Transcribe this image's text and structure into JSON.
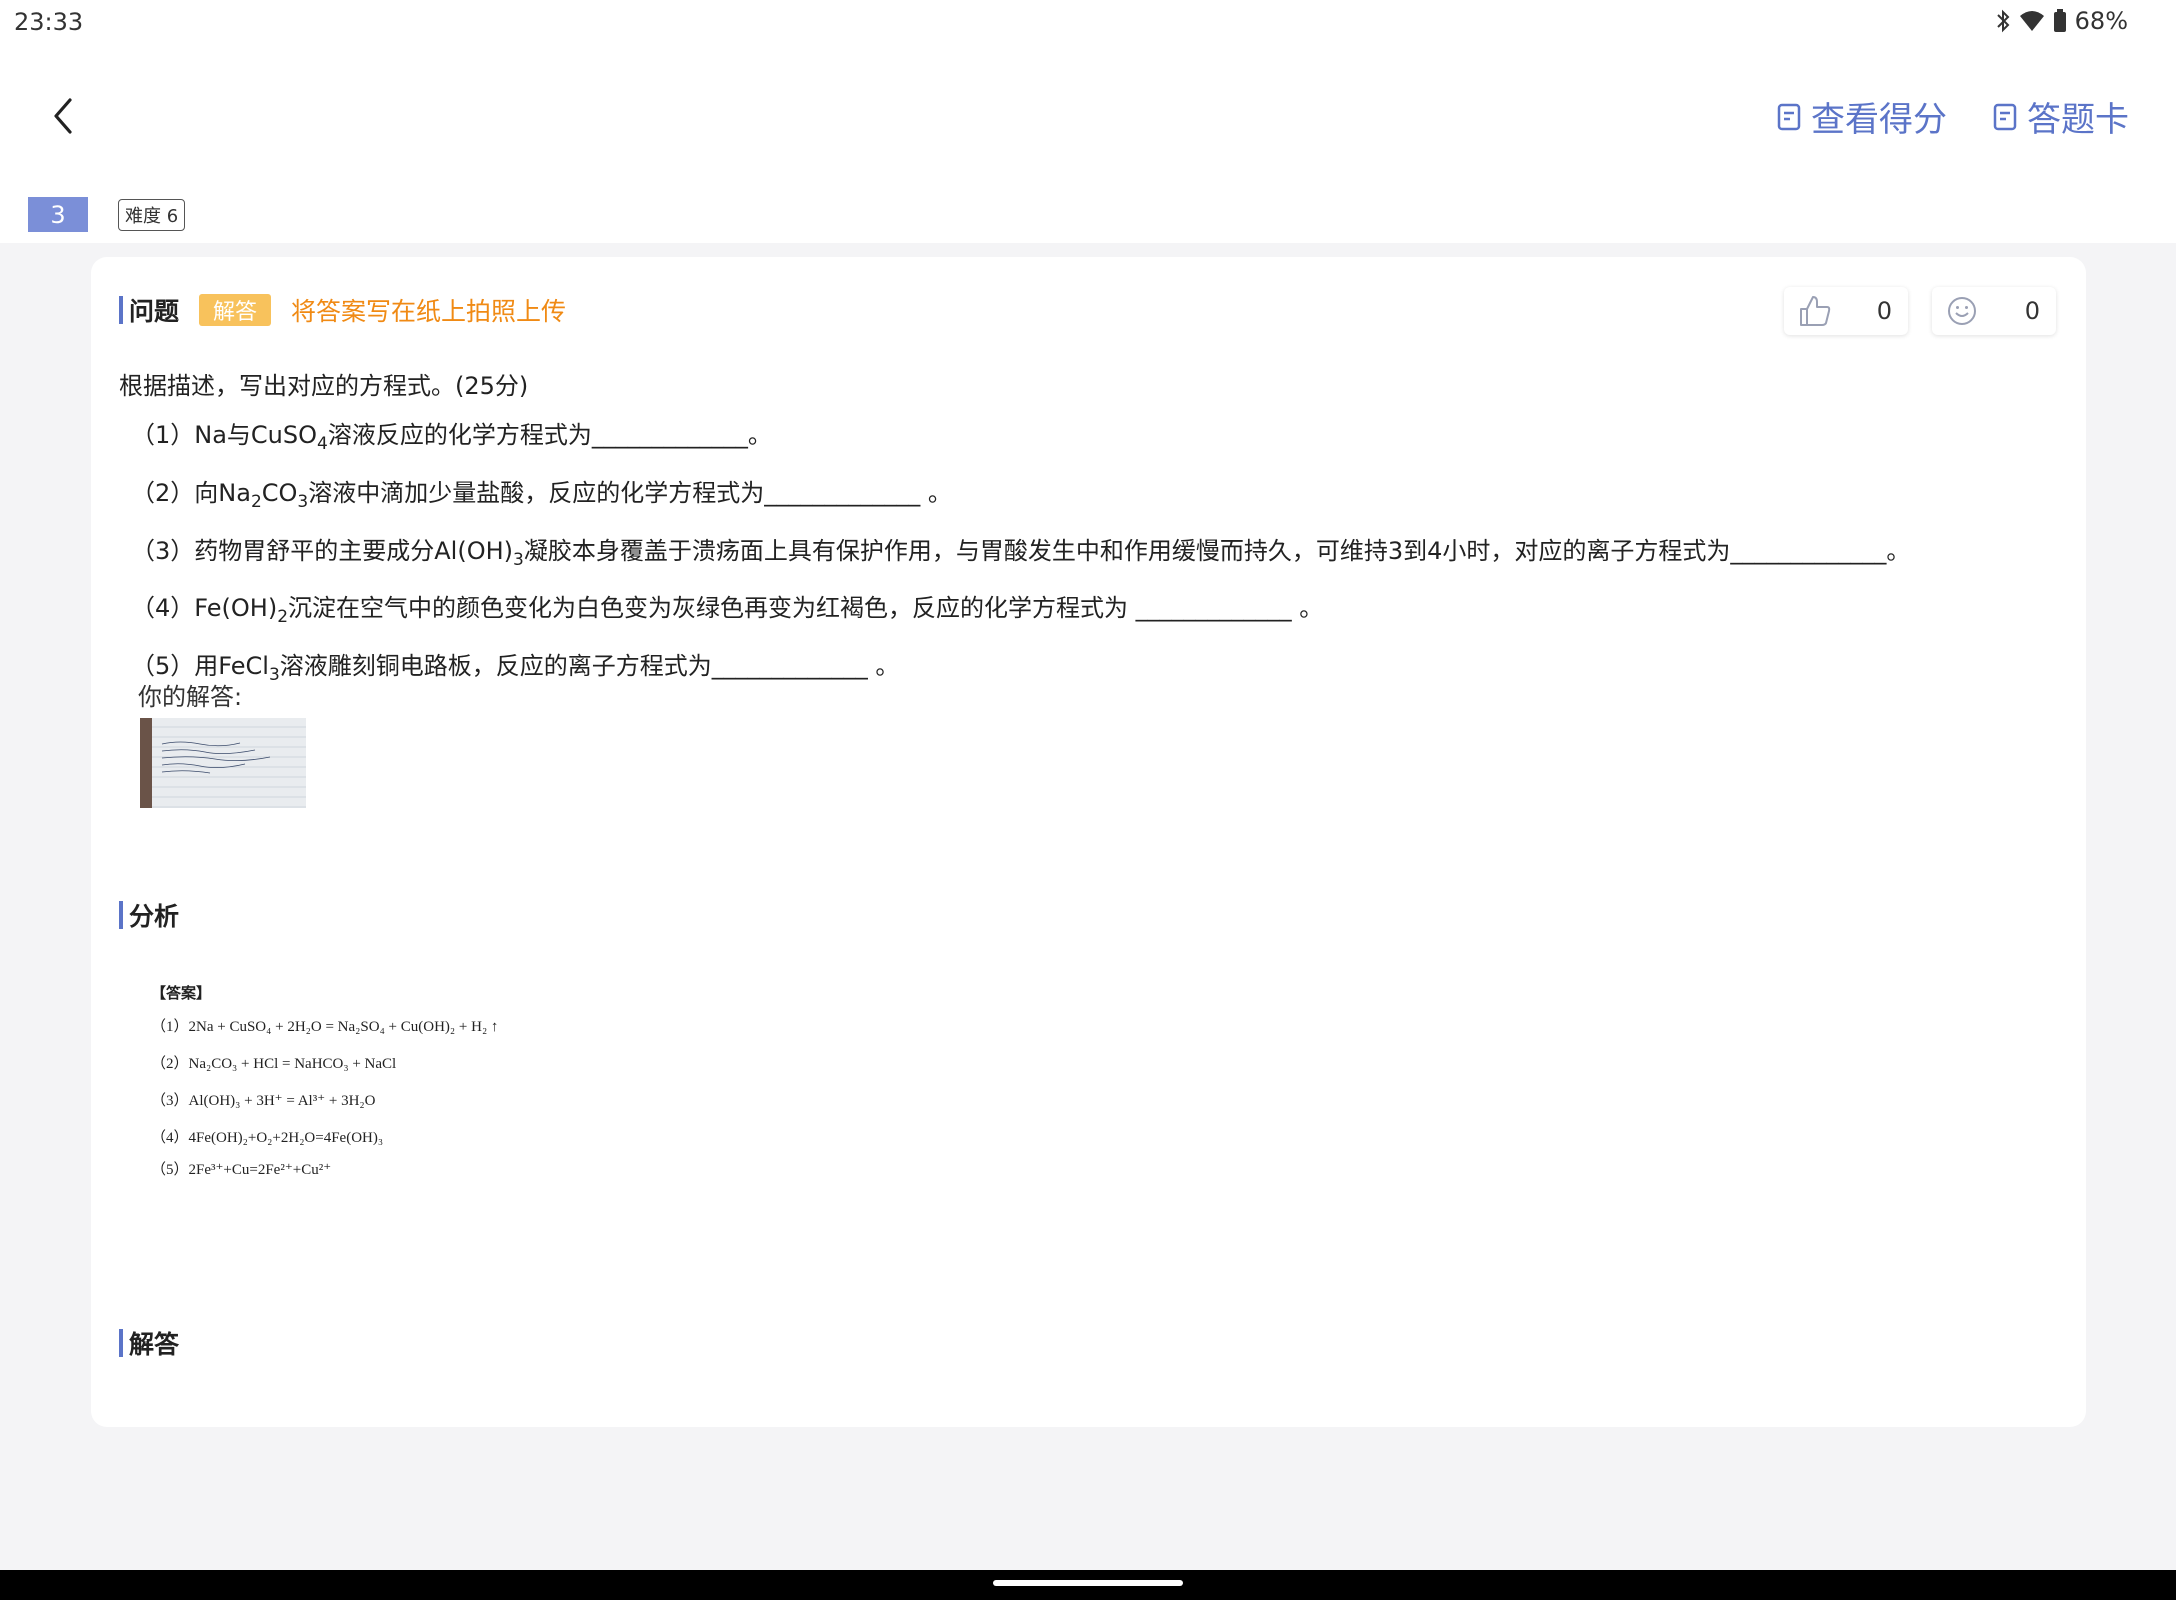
{
  "status_bar": {
    "time": "23:33",
    "battery": "68%",
    "icons": [
      "bluetooth-icon",
      "wifi-icon",
      "battery-icon"
    ]
  },
  "nav": {
    "back_icon": "chevron-left-icon",
    "view_score": "查看得分",
    "answer_card": "答题卡"
  },
  "question_meta": {
    "number": "3",
    "difficulty": "难度 6"
  },
  "question": {
    "section_title": "问题",
    "badge": "解答",
    "upload_hint": "将答案写在纸上拍照上传",
    "likes": "0",
    "smiles": "0",
    "intro": "根据描述，写出对应的方程式。(25分)",
    "items": [
      {
        "prefix": "（1）Na与CuSO",
        "sub": "4",
        "suffix": "溶液反应的化学方程式为_____________。"
      },
      {
        "prefix": "（2）向Na",
        "sub": "2",
        "middle": "CO",
        "sub2": "3",
        "suffix": "溶液中滴加少量盐酸，反应的化学方程式为_____________ 。"
      },
      {
        "prefix": "（3）药物胃舒平的主要成分Al(OH)",
        "sub": "3",
        "suffix": "凝胶本身覆盖于溃疡面上具有保护作用，与胃酸发生中和作用缓慢而持久，可维持3到4小时，对应的离子方程式为_____________。"
      },
      {
        "prefix": "（4）Fe(OH)",
        "sub": "2",
        "suffix": "沉淀在空气中的颜色变化为白色变为灰绿色再变为红褐色，反应的化学方程式为 _____________ 。"
      },
      {
        "prefix": "（5）用FeCl",
        "sub": "3",
        "suffix": "溶液雕刻铜电路板，反应的离子方程式为_____________ 。"
      }
    ],
    "your_answer_label": "你的解答:"
  },
  "analysis": {
    "section_title": "分析",
    "answer_head": "【答案】",
    "lines": [
      "（1）2Na + CuSO₄ + 2H₂O = Na₂SO₄ + Cu(OH)₂ + H₂ ↑",
      "（2）Na₂CO₃ + HCl = NaHCO₃ + NaCl",
      "（3）Al(OH)₃ + 3H⁺ = Al³⁺ + 3H₂O",
      "（4）4Fe(OH)₂+O₂+2H₂O=4Fe(OH)₃",
      "（5）2Fe³⁺+Cu=2Fe²⁺+Cu²⁺"
    ]
  },
  "solution": {
    "section_title": "解答"
  },
  "colors": {
    "accent": "#5b74c8",
    "badge": "#f8c25c",
    "hint": "#f08a14",
    "qnumber": "#7b8fd8"
  }
}
